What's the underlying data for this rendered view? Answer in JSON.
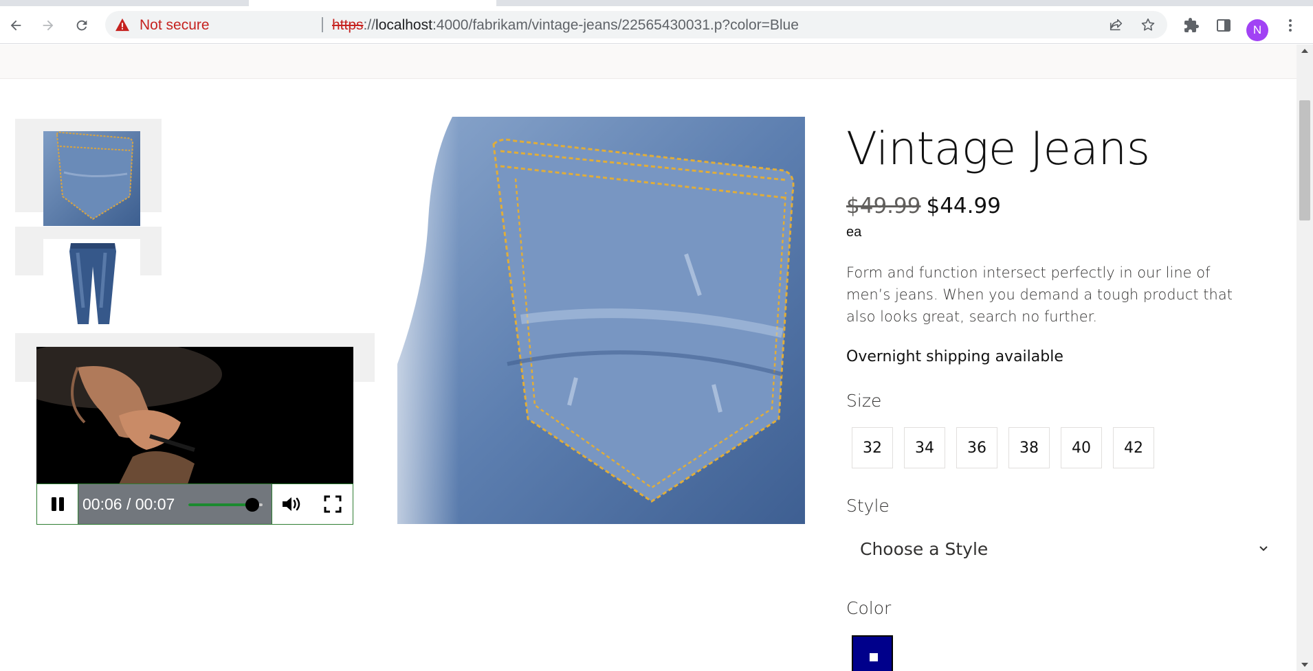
{
  "browser": {
    "security_label": "Not secure",
    "url_scheme": "https",
    "url_separator": "://",
    "url_host": "localhost",
    "url_path": ":4000/fabrikam/vintage-jeans/22565430031.p?color=Blue",
    "profile_initial": "N",
    "icons": [
      "back-arrow-icon",
      "forward-arrow-icon",
      "reload-icon",
      "warning-icon",
      "share-icon",
      "star-icon",
      "extensions-icon",
      "side-panel-icon",
      "kebab-menu-icon"
    ]
  },
  "product": {
    "title": "Vintage Jeans",
    "old_price": "$49.99",
    "price": "$44.99",
    "unit": "ea",
    "description": "Form and function intersect perfectly in our line of men’s jeans. When you demand a tough product that also looks great, search no further.",
    "shipping": "Overnight shipping available"
  },
  "size": {
    "label": "Size",
    "options": [
      "32",
      "34",
      "36",
      "38",
      "40",
      "42"
    ]
  },
  "style": {
    "label": "Style",
    "placeholder": "Choose a Style"
  },
  "color": {
    "label": "Color",
    "selected_hex": "#00008b"
  },
  "video": {
    "time": "00:06 / 00:07",
    "progress": 0.857,
    "accent": "#1b8a2f",
    "icons": [
      "pause-icon",
      "volume-icon",
      "fullscreen-icon"
    ]
  },
  "colors": {
    "warning_red": "#c5221f",
    "avatar": "#a142f4",
    "denim": "#5b7fae"
  }
}
